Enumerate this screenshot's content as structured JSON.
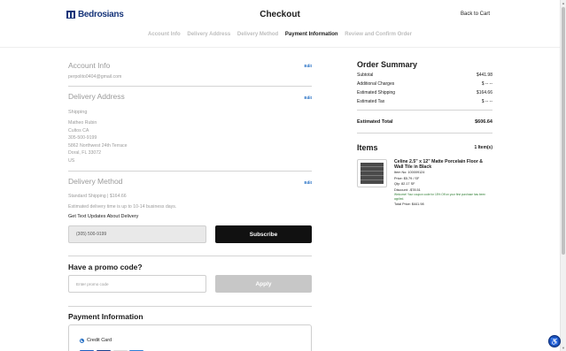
{
  "header": {
    "logo_text": "Bedrosians",
    "title": "Checkout",
    "back_link": "Back to Cart"
  },
  "steps": [
    {
      "label": "Account Info",
      "active": false
    },
    {
      "label": "Delivery Address",
      "active": false
    },
    {
      "label": "Delivery Method",
      "active": false
    },
    {
      "label": "Payment Information",
      "active": true
    },
    {
      "label": "Review and Confirm Order",
      "active": false
    }
  ],
  "account": {
    "title": "Account Info",
    "edit": "Edit",
    "email": "perpolito0404@gmail.com"
  },
  "address": {
    "title": "Delivery Address",
    "edit": "Edit",
    "sub_label": "Shipping",
    "lines": [
      "Matheo Rubin",
      "Cultos CA",
      "305-500-9199",
      "5862 Northwest 24th Terrace",
      "Doral, FL 33072",
      "US"
    ]
  },
  "method": {
    "title": "Delivery Method",
    "edit": "Edit",
    "shipping": "Standard Shipping | $164.66",
    "note": "Estimated delivery time is up to 10-14 business days.",
    "text_updates_label": "Get Text Updates About Delivery",
    "phone_value": "(305) 500-9199",
    "subscribe_label": "Subscribe"
  },
  "promo": {
    "title": "Have a promo code?",
    "placeholder": "Enter promo code",
    "apply_label": "Apply"
  },
  "payment": {
    "title": "Payment Information",
    "option_label": "Credit Card",
    "card_colors": [
      "#1f5fbf",
      "#1a3e8c",
      "#ffffff",
      "#2f7fd6"
    ]
  },
  "summary": {
    "title": "Order Summary",
    "rows": [
      {
        "label": "Subtotal",
        "value": "$441.98"
      },
      {
        "label": "Additional Charges",
        "value": "$ -- --"
      },
      {
        "label": "Estimated Shipping",
        "value": "$164.66"
      },
      {
        "label": "Estimated Tax",
        "value": "$ -- --"
      }
    ],
    "total_label": "Estimated Total",
    "total_value": "$606.64"
  },
  "items": {
    "title": "Items",
    "count": "1 Item(s)",
    "product": {
      "name": "Celine 2.5\" x 12\" Matte Porcelain Floor & Wall Tile in Black",
      "item_no": "Item No: 100009124",
      "price": "Price: $5.79 / SF",
      "qty": "Qty: 82.17 SF",
      "discount": "Discount: -$78.51",
      "note": "Welcome! Your coupon code for 15% Off on your first purchase has been applied.",
      "total": "Total Price: $441.98"
    }
  },
  "colors": {
    "brand": "#17357a",
    "link": "#1565c0",
    "subscribe_bg": "#111111",
    "apply_bg": "#c7c7c7",
    "green": "#2e7d32"
  }
}
